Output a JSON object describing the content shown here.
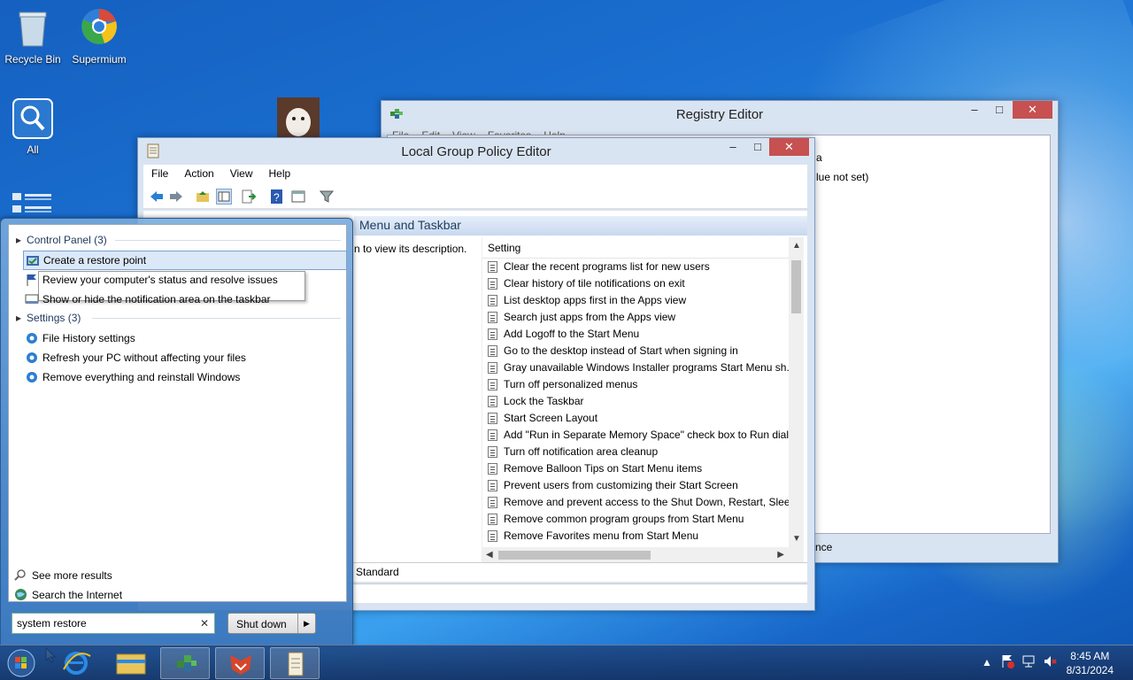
{
  "desktop": {
    "icons": [
      {
        "label": "Recycle Bin"
      },
      {
        "label": "Supermium"
      },
      {
        "label": "All"
      }
    ]
  },
  "registry_editor": {
    "title": "Registry Editor",
    "menu": [
      "File",
      "Edit",
      "View",
      "Favorites",
      "Help"
    ],
    "value_fragment_1": "a",
    "value_fragment_2": "lue not set)",
    "status_fragment": "nce"
  },
  "gpedit": {
    "title": "Local Group Policy Editor",
    "menu": [
      "File",
      "Action",
      "Help",
      "View"
    ],
    "menu_items": {
      "file": "File",
      "action": "Action",
      "view": "View",
      "help": "Help"
    },
    "banner": "Menu and Taskbar",
    "description": "n to view its description.",
    "column_setting": "Setting",
    "settings": [
      "Clear the recent programs list for new users",
      "Clear history of tile notifications on exit",
      "List desktop apps first in the Apps view",
      "Search just apps from the Apps view",
      "Add Logoff to the Start Menu",
      "Go to the desktop instead of Start when signing in",
      "Gray unavailable Windows Installer programs Start Menu sh...",
      "Turn off personalized menus",
      "Lock the Taskbar",
      "Start Screen Layout",
      "Add \"Run in Separate Memory Space\" check box to Run dial...",
      "Turn off notification area cleanup",
      "Remove Balloon Tips on Start Menu items",
      "Prevent users from customizing their Start Screen",
      "Remove and prevent access to the Shut Down, Restart, Sleep...",
      "Remove common program groups from Start Menu",
      "Remove Favorites menu from Start Menu"
    ],
    "tab_standard": "Standard"
  },
  "start_menu": {
    "group_control_panel": "Control Panel (3)",
    "control_panel_items": [
      "Create a restore point",
      "Review your computer's status and resolve issues",
      "Show or hide the notification area on the taskbar"
    ],
    "group_settings": "Settings (3)",
    "settings_items": [
      "File History settings",
      "Refresh your PC without affecting your files",
      "Remove everything and reinstall Windows"
    ],
    "see_more": "See more results",
    "search_internet": "Search the Internet",
    "search_value": "system restore",
    "shutdown_label": "Shut down"
  },
  "taskbar": {
    "time": "8:45 AM",
    "date": "8/31/2024"
  }
}
